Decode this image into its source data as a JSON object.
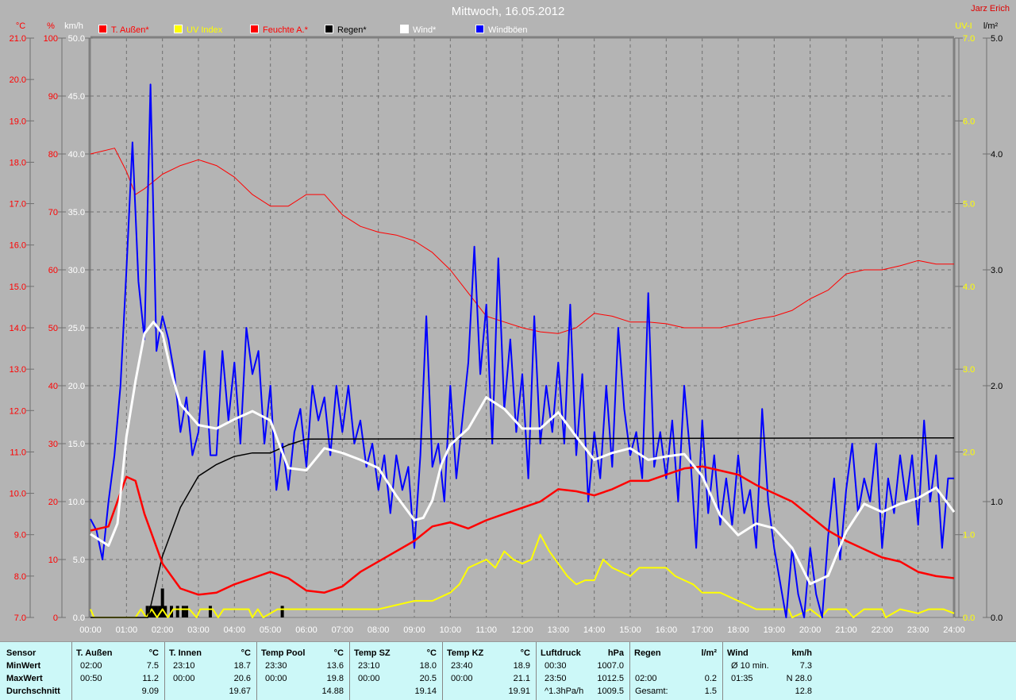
{
  "header": {
    "title": "Mittwoch, 16.05.2012",
    "author": "Jarz Erich"
  },
  "legend": [
    {
      "label": "T. Außen*",
      "color": "#ff0000",
      "text_color": "#ff0000"
    },
    {
      "label": "UV Index",
      "color": "#ffff00",
      "text_color": "#ffff00"
    },
    {
      "label": "Feuchte A.*",
      "color": "#ff0000",
      "text_color": "#ff0000"
    },
    {
      "label": "Regen*",
      "color": "#000000",
      "text_color": "#000000"
    },
    {
      "label": "Wind*",
      "color": "#ffffff",
      "text_color": "#ffffff"
    },
    {
      "label": "Windböen",
      "color": "#0000ff",
      "text_color": "#ffffff"
    }
  ],
  "chart_data": {
    "type": "line",
    "title": "Mittwoch, 16.05.2012",
    "grid": true,
    "xlabel": "",
    "x_ticks": [
      "00:00",
      "01:00",
      "02:00",
      "03:00",
      "04:00",
      "05:00",
      "06:00",
      "07:00",
      "08:00",
      "09:00",
      "10:00",
      "11:00",
      "12:00",
      "13:00",
      "14:00",
      "15:00",
      "16:00",
      "17:00",
      "18:00",
      "19:00",
      "20:00",
      "21:00",
      "22:00",
      "23:00",
      "24:00"
    ],
    "xlim_hours": [
      0,
      24
    ],
    "axes": {
      "temp": {
        "unit": "°C",
        "range": [
          7,
          21
        ],
        "ticks": [
          "7.0",
          "8.0",
          "9.0",
          "10.0",
          "11.0",
          "12.0",
          "13.0",
          "14.0",
          "15.0",
          "16.0",
          "17.0",
          "18.0",
          "19.0",
          "20.0",
          "21.0"
        ],
        "color": "#ff0000"
      },
      "humidity": {
        "unit": "%",
        "range": [
          0,
          100
        ],
        "ticks": [
          "0",
          "10",
          "20",
          "30",
          "40",
          "50",
          "60",
          "70",
          "80",
          "90",
          "100"
        ],
        "color": "#ff0000"
      },
      "wind": {
        "unit": "km/h",
        "range": [
          0,
          50
        ],
        "ticks": [
          "0.0",
          "5.0",
          "10.0",
          "15.0",
          "20.0",
          "25.0",
          "30.0",
          "35.0",
          "40.0",
          "45.0",
          "50.0"
        ],
        "color": "#ffffff"
      },
      "uv": {
        "unit": "UV-I",
        "range": [
          0,
          7
        ],
        "ticks": [
          "0.0",
          "1.0",
          "2.0",
          "3.0",
          "4.0",
          "5.0",
          "6.0",
          "7.0"
        ],
        "color": "#ffff00"
      },
      "rain": {
        "unit": "l/m²",
        "range": [
          0,
          5
        ],
        "ticks": [
          "0.0",
          "1.0",
          "2.0",
          "3.0",
          "4.0",
          "5.0"
        ],
        "color": "#000000"
      }
    },
    "series": [
      {
        "name": "T. Außen",
        "axis": "temp",
        "color": "#ff0000",
        "width": 2.5,
        "x": [
          0,
          0.5,
          0.83,
          1,
          1.25,
          1.5,
          2,
          2.5,
          3,
          3.5,
          4,
          4.5,
          5,
          5.5,
          6,
          6.5,
          7,
          7.5,
          8,
          8.5,
          9,
          9.5,
          10,
          10.5,
          11,
          11.5,
          12,
          12.5,
          13,
          13.5,
          14,
          14.5,
          15,
          15.5,
          16,
          16.5,
          17,
          17.5,
          18,
          18.5,
          19,
          19.5,
          20,
          20.5,
          21,
          21.5,
          22,
          22.5,
          23,
          23.5,
          24
        ],
        "y": [
          9.1,
          9.2,
          10.0,
          10.4,
          10.3,
          9.5,
          8.3,
          7.7,
          7.55,
          7.6,
          7.8,
          7.95,
          8.1,
          7.95,
          7.65,
          7.6,
          7.75,
          8.1,
          8.35,
          8.6,
          8.85,
          9.2,
          9.3,
          9.15,
          9.35,
          9.5,
          9.65,
          9.8,
          10.1,
          10.05,
          9.95,
          10.1,
          10.3,
          10.3,
          10.45,
          10.6,
          10.65,
          10.55,
          10.45,
          10.2,
          10.0,
          9.8,
          9.45,
          9.1,
          8.85,
          8.65,
          8.45,
          8.35,
          8.1,
          8.0,
          7.95
        ]
      },
      {
        "name": "Feuchte A.",
        "axis": "humidity",
        "color": "#ff0000",
        "width": 1,
        "x": [
          0,
          0.67,
          1,
          1.25,
          1.5,
          2,
          2.5,
          3,
          3.5,
          4,
          4.5,
          5,
          5.5,
          6,
          6.5,
          7,
          7.5,
          8,
          8.5,
          9,
          9.5,
          10,
          10.5,
          11,
          11.5,
          12,
          12.5,
          13,
          13.5,
          14,
          14.5,
          15,
          15.5,
          16,
          16.5,
          17,
          17.5,
          18,
          18.5,
          19,
          19.5,
          20,
          20.5,
          21,
          21.5,
          22,
          22.5,
          23,
          23.5,
          24
        ],
        "y": [
          80,
          81,
          77,
          73,
          74,
          76.5,
          78,
          79,
          78,
          76,
          73,
          71,
          71,
          73,
          73,
          69.5,
          67.5,
          66.5,
          66,
          65,
          63,
          60,
          56,
          52,
          51,
          50,
          49.3,
          49,
          50,
          52.5,
          52,
          51,
          51,
          50.7,
          50,
          50,
          50,
          50.7,
          51.5,
          52,
          53,
          55,
          56.5,
          59.3,
          60,
          60,
          60.7,
          61.6,
          61,
          61
        ]
      },
      {
        "name": "Regen",
        "axis": "rain",
        "color": "#000000",
        "width": 1.5,
        "x": [
          0,
          1.6,
          2,
          2.5,
          3,
          3.5,
          4,
          4.5,
          5,
          5.5,
          6,
          24
        ],
        "y": [
          0,
          0,
          0.53,
          0.95,
          1.22,
          1.32,
          1.39,
          1.42,
          1.42,
          1.49,
          1.54,
          1.55
        ]
      },
      {
        "name": "Wind",
        "axis": "wind",
        "color": "#ffffff",
        "width": 3,
        "x": [
          0,
          0.5,
          0.75,
          1,
          1.25,
          1.5,
          1.75,
          2,
          2.25,
          2.5,
          3,
          3.5,
          4,
          4.5,
          5,
          5.25,
          5.5,
          6,
          6.5,
          7,
          7.5,
          8,
          8.5,
          9,
          9.25,
          9.5,
          9.75,
          10,
          10.5,
          11,
          11.5,
          12,
          12.5,
          13,
          13.5,
          14,
          14.5,
          15,
          15.5,
          16,
          16.5,
          17,
          17.5,
          18,
          18.5,
          19,
          19.5,
          20,
          20.5,
          21,
          21.5,
          22,
          22.5,
          23,
          23.5,
          24
        ],
        "y": [
          7.2,
          6.2,
          8.1,
          15.6,
          20.4,
          24.5,
          25.5,
          24.5,
          21.1,
          18.4,
          16.6,
          16.3,
          17.1,
          17.8,
          17,
          14.9,
          12.9,
          12.7,
          14.6,
          14.2,
          13.6,
          12.9,
          10.5,
          8.4,
          8.6,
          10.1,
          13.2,
          14.9,
          16.3,
          19,
          18,
          16.3,
          16.3,
          17.7,
          15.6,
          13.6,
          14.2,
          14.6,
          13.6,
          13.9,
          14.1,
          12.2,
          8.8,
          7.1,
          8.1,
          7.7,
          6,
          2.9,
          3.6,
          7.4,
          9.8,
          9.1,
          9.8,
          10.3,
          11.2,
          9.1
        ]
      },
      {
        "name": "Windböen",
        "axis": "wind",
        "color": "#0000ff",
        "width": 2,
        "step_minutes": 10,
        "y": [
          8.5,
          7.5,
          5,
          10,
          14,
          20,
          30,
          41,
          29,
          24,
          46,
          23,
          26,
          24,
          21,
          16,
          19,
          14,
          16,
          23,
          14,
          14,
          23,
          17,
          22,
          15,
          25,
          21,
          23,
          15,
          20,
          11,
          15,
          11,
          16,
          18,
          13,
          20,
          17,
          19,
          14,
          20,
          16,
          20,
          15,
          17,
          13,
          15,
          11,
          14,
          9,
          14,
          11,
          13,
          6,
          14,
          26,
          13,
          15,
          10,
          20,
          12,
          17,
          22,
          32,
          21,
          27,
          15,
          31,
          18,
          24,
          16,
          21,
          12,
          26,
          15,
          20,
          16,
          22,
          15,
          27,
          14,
          21,
          10,
          16,
          12,
          20,
          13,
          25,
          18,
          14,
          16,
          12,
          28,
          13,
          16,
          12,
          17,
          10,
          20,
          14,
          6,
          17,
          9,
          14,
          8,
          12,
          8,
          14,
          9,
          11,
          6,
          18,
          10,
          6,
          3,
          0,
          6,
          2,
          0,
          6,
          2,
          0,
          7,
          12,
          5,
          11,
          15,
          9,
          12,
          10,
          15,
          6,
          12,
          9,
          14,
          10,
          14,
          8,
          17,
          10,
          14,
          6,
          12,
          12
        ]
      },
      {
        "name": "UV Index",
        "axis": "uv",
        "color": "#ffff00",
        "width": 2,
        "x": [
          0,
          0.1,
          1.25,
          1.4,
          1.55,
          1.7,
          1.85,
          2,
          2.15,
          2.3,
          2.5,
          2.75,
          2.95,
          3.05,
          3.4,
          3.55,
          3.7,
          4.4,
          4.5,
          4.65,
          4.8,
          5.2,
          5.35,
          5.5,
          7.5,
          8,
          8.5,
          9,
          9.5,
          10,
          10.25,
          10.5,
          11,
          11.25,
          11.5,
          11.75,
          12,
          12.25,
          12.5,
          12.75,
          13,
          13.25,
          13.5,
          13.75,
          14,
          14.25,
          14.5,
          14.75,
          15,
          15.25,
          15.5,
          16,
          16.25,
          16.5,
          16.75,
          17,
          17.5,
          18,
          18.5,
          19,
          19.4,
          19.5,
          20,
          20.3,
          20.5,
          21,
          21.2,
          21.5,
          22,
          22.1,
          22.5,
          23,
          23.3,
          23.7,
          24
        ],
        "y": [
          0.1,
          0,
          0,
          0.1,
          0,
          0.1,
          0,
          0.1,
          0,
          0.1,
          0.1,
          0.1,
          0,
          0.1,
          0.1,
          0,
          0.1,
          0.1,
          0,
          0.1,
          0,
          0.1,
          0.1,
          0.1,
          0.1,
          0.1,
          0.15,
          0.2,
          0.2,
          0.3,
          0.4,
          0.6,
          0.7,
          0.6,
          0.8,
          0.7,
          0.65,
          0.7,
          1.0,
          0.8,
          0.65,
          0.5,
          0.4,
          0.45,
          0.45,
          0.7,
          0.6,
          0.55,
          0.5,
          0.6,
          0.6,
          0.6,
          0.5,
          0.45,
          0.4,
          0.3,
          0.3,
          0.2,
          0.1,
          0.1,
          0.1,
          0,
          0.1,
          0,
          0.1,
          0.1,
          0,
          0.1,
          0.1,
          0,
          0.1,
          0.05,
          0.1,
          0.1,
          0.05
        ]
      },
      {
        "name": "Regen Intervall",
        "axis": "rain",
        "color": "#000000",
        "type": "bar",
        "x": [
          1.58,
          1.67,
          1.75,
          1.83,
          1.92,
          2.0,
          2.08,
          2.25,
          2.42,
          2.58,
          2.67,
          3.33,
          5.33
        ],
        "y": [
          0.1,
          0.1,
          0.1,
          0.1,
          0.1,
          0.25,
          0.1,
          0.1,
          0.1,
          0.1,
          0.1,
          0.1,
          0.1
        ]
      }
    ]
  },
  "table": {
    "row_labels": [
      "Sensor",
      "MinWert",
      "MaxWert",
      "Durchschnitt"
    ],
    "columns": [
      {
        "name": "T. Außen",
        "unit": "°C",
        "rows": [
          [
            "02:00",
            "7.5"
          ],
          [
            "00:50",
            "11.2"
          ],
          [
            "",
            "9.09"
          ]
        ]
      },
      {
        "name": "T. Innen",
        "unit": "°C",
        "rows": [
          [
            "23:10",
            "18.7"
          ],
          [
            "00:00",
            "20.6"
          ],
          [
            "",
            "19.67"
          ]
        ]
      },
      {
        "name": "Temp Pool",
        "unit": "°C",
        "rows": [
          [
            "23:30",
            "13.6"
          ],
          [
            "00:00",
            "19.8"
          ],
          [
            "",
            "14.88"
          ]
        ]
      },
      {
        "name": "Temp SZ",
        "unit": "°C",
        "rows": [
          [
            "23:10",
            "18.0"
          ],
          [
            "00:00",
            "20.5"
          ],
          [
            "",
            "19.14"
          ]
        ]
      },
      {
        "name": "Temp KZ",
        "unit": "°C",
        "rows": [
          [
            "23:40",
            "18.9"
          ],
          [
            "00:00",
            "21.1"
          ],
          [
            "",
            "19.91"
          ]
        ]
      },
      {
        "name": "Luftdruck",
        "unit": "hPa",
        "rows": [
          [
            "00:30",
            "1007.0"
          ],
          [
            "23:50",
            "1012.5"
          ],
          [
            "^1.3hPa/h",
            "1009.5"
          ]
        ]
      },
      {
        "name": "Regen",
        "unit": "l/m²",
        "rows": [
          [
            "",
            ""
          ],
          [
            "02:00",
            "0.2"
          ],
          [
            "Gesamt:",
            "1.5"
          ]
        ]
      },
      {
        "name": "Wind",
        "unit": "km/h",
        "rows": [
          [
            "Ø 10 min.",
            "7.3"
          ],
          [
            "01:35",
            "N 28.0"
          ],
          [
            "",
            "12.8"
          ]
        ]
      }
    ]
  }
}
